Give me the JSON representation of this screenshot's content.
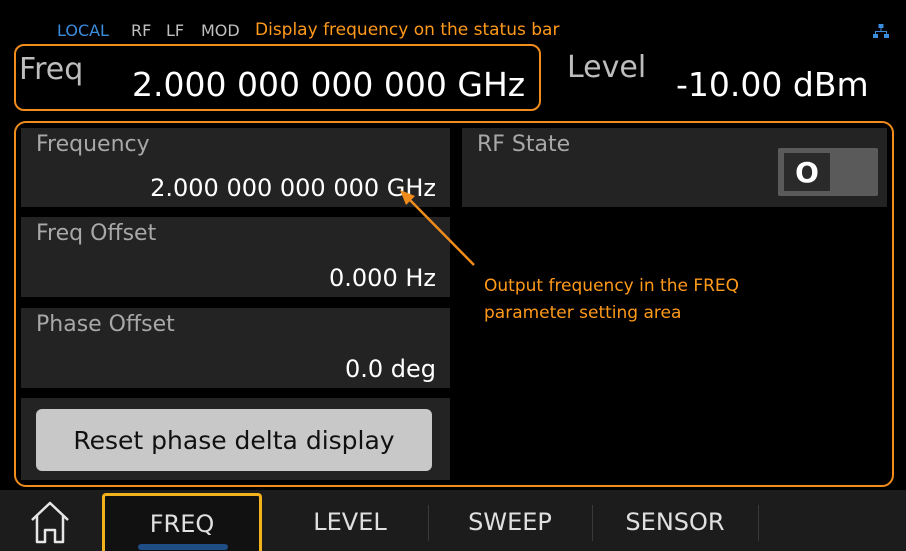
{
  "status_bar": {
    "local": "LOCAL",
    "rf": "RF",
    "lf": "LF",
    "mod": "MOD",
    "annotation": "Display frequency on the status bar",
    "network_icon": "network-icon"
  },
  "header": {
    "freq_label": "Freq",
    "freq_value": "2.000 000 000 000  GHz",
    "level_label": "Level",
    "level_value": "-10.00  dBm"
  },
  "params": {
    "frequency": {
      "label": "Frequency",
      "value": "2.000 000 000 000 GHz"
    },
    "freq_offset": {
      "label": "Freq Offset",
      "value": "0.000  Hz"
    },
    "phase_offset": {
      "label": "Phase Offset",
      "value": "0.0  deg"
    },
    "reset_button": "Reset phase delta display",
    "rf_state": {
      "label": "RF State",
      "toggle": "O"
    }
  },
  "annotation_output": "Output frequency in the FREQ parameter setting area",
  "tabs": {
    "freq": "FREQ",
    "level": "LEVEL",
    "sweep": "SWEEP",
    "sensor": "SENSOR"
  },
  "colors": {
    "accent_orange": "#f08c1c",
    "annotation_text": "#ff9a1a",
    "local_blue": "#3a8ddc",
    "tab_highlight": "#f2b21c"
  }
}
